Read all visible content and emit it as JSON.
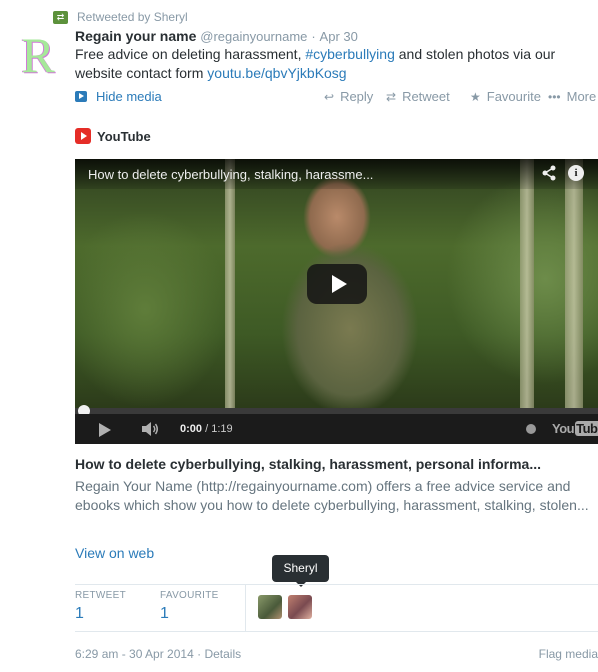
{
  "retweet": {
    "label": "Retweeted by Sheryl",
    "icon": "retweet-icon"
  },
  "avatar": {
    "letter": "R"
  },
  "tweet": {
    "fullname": "Regain your name",
    "username": "@regainyourname",
    "separator": "·",
    "date": "Apr 30",
    "text_1": "Free advice on deleting harassment, ",
    "hashtag": "#cyberbullying",
    "text_2": " and stolen photos via our website contact form ",
    "link": "youtu.be/qbvYjkbKosg"
  },
  "actions": {
    "hide_media": "Hide media",
    "reply": "Reply",
    "retweet": "Retweet",
    "favourite": "Favourite",
    "more": "More"
  },
  "media": {
    "source": "YouTube",
    "video_title": "How to delete cyberbullying, stalking, harassme...",
    "time_current": "0:00",
    "time_total": " / 1:19",
    "progress": 0,
    "logo": "You",
    "logo_box": "Tube"
  },
  "card": {
    "title": "How to delete cyberbullying, stalking, harassment, personal informa...",
    "description": "Regain Your Name (http://regainyourname.com) offers a free advice service and ebooks which show you how to delete cyberbullying, harassment, stalking, stolen...",
    "view_link": "View on web"
  },
  "tooltip": "Sheryl",
  "stats": {
    "retweet_label": "RETWEET",
    "retweet_count": "1",
    "favourite_label": "FAVOURITE",
    "favourite_count": "1"
  },
  "footer": {
    "timestamp": "6:29 am - 30 Apr 2014",
    "separator": "·",
    "details": "Details",
    "flag": "Flag media"
  },
  "colors": {
    "link": "#2b7bb9",
    "muted": "#8899a6",
    "retweet_green": "#5c913b",
    "youtube_red": "#e52d27"
  }
}
